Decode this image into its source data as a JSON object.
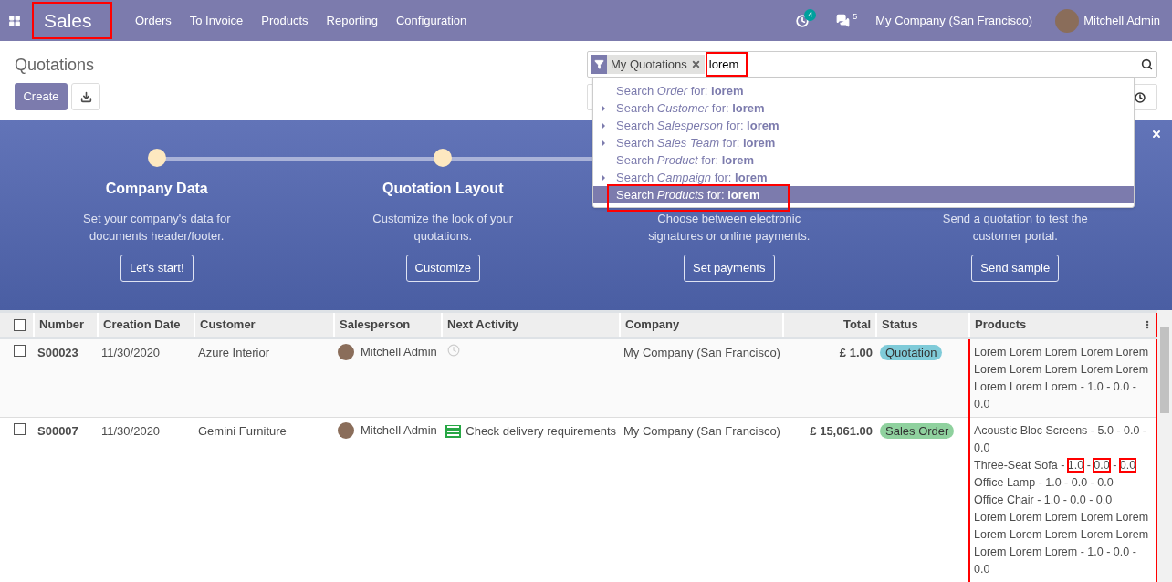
{
  "navbar": {
    "app_title": "Sales",
    "app_title_annotated": true,
    "menu": [
      "Orders",
      "To Invoice",
      "Products",
      "Reporting",
      "Configuration"
    ],
    "activity_count": "4",
    "message_count": "5",
    "company": "My Company (San Francisco)",
    "user": "Mitchell Admin"
  },
  "control_panel": {
    "title": "Quotations",
    "create_button": "Create",
    "search": {
      "facet": "My Quotations",
      "value": "lorem",
      "value_annotated": true
    },
    "suggestions": [
      {
        "text": "Search *Order* for: **lorem**",
        "expandable": false,
        "selected": false,
        "annotated": false
      },
      {
        "text": "Search *Customer* for: **lorem**",
        "expandable": true,
        "selected": false,
        "annotated": false
      },
      {
        "text": "Search *Salesperson* for: **lorem**",
        "expandable": true,
        "selected": false,
        "annotated": false
      },
      {
        "text": "Search *Sales Team* for: **lorem**",
        "expandable": true,
        "selected": false,
        "annotated": false
      },
      {
        "text": "Search *Product* for: **lorem**",
        "expandable": false,
        "selected": false,
        "annotated": false
      },
      {
        "text": "Search *Campaign* for: **lorem**",
        "expandable": true,
        "selected": false,
        "annotated": false
      },
      {
        "text": "Search *Products* for: **lorem**",
        "expandable": false,
        "selected": true,
        "annotated": true
      }
    ]
  },
  "onboarding": {
    "steps": [
      {
        "title": "Company Data",
        "description_lines": [
          "Set your company's data for",
          "documents header/footer."
        ],
        "button": "Let's start!"
      },
      {
        "title": "Quotation Layout",
        "description_lines": [
          "Customize the look of your",
          "quotations."
        ],
        "button": "Customize"
      },
      {
        "description_lines": [
          "Choose between electronic",
          "signatures or online payments."
        ],
        "button": "Set payments"
      },
      {
        "description_lines": [
          "Send a quotation to test the",
          "customer portal."
        ],
        "button": "Send sample"
      }
    ]
  },
  "table": {
    "all_selected": false,
    "columns": [
      "Number",
      "Creation Date",
      "Customer",
      "Salesperson",
      "Next Activity",
      "Company",
      "Total",
      "Status",
      "Products"
    ],
    "products_column_annotated": true,
    "rows": [
      {
        "selected": false,
        "number": "S00023",
        "date": "11/30/2020",
        "customer": "Azure Interior",
        "salesperson": "Mitchell Admin",
        "activity": {
          "kind": "none"
        },
        "company": "My Company (San Francisco)",
        "total": "£ 1.00",
        "status": "Quotation",
        "color": "#7fcbd9",
        "products": [
          {
            "segments": [
              {
                "text": "Lorem Lorem Lorem Lorem Lorem Lorem Lorem Lorem Lorem Lorem Lorem Lorem Lorem - 1.0 - 0.0 - 0.0",
                "marked": false
              }
            ]
          }
        ]
      },
      {
        "selected": false,
        "number": "S00007",
        "date": "11/30/2020",
        "customer": "Gemini Furniture",
        "salesperson": "Mitchell Admin",
        "activity": {
          "kind": "task",
          "text": "Check delivery requirements"
        },
        "company": "My Company (San Francisco)",
        "total": "£ 15,061.00",
        "status": "Sales Order",
        "color": "#8fd19e",
        "products": [
          {
            "segments": [
              {
                "text": "Acoustic Bloc Screens - 5.0 - 0.0 - 0.0",
                "marked": false
              }
            ]
          },
          {
            "segments": [
              {
                "text": "Three-Seat Sofa - ",
                "marked": false
              },
              {
                "text": "1.0",
                "marked": true
              },
              {
                "text": " - ",
                "marked": false
              },
              {
                "text": "0.0",
                "marked": true
              },
              {
                "text": " - ",
                "marked": false
              },
              {
                "text": "0.0",
                "marked": true
              }
            ]
          },
          {
            "segments": [
              {
                "text": "Office Lamp - 1.0 - 0.0 - 0.0",
                "marked": false
              }
            ]
          },
          {
            "segments": [
              {
                "text": "Office Chair - 1.0 - 0.0 - 0.0",
                "marked": false
              }
            ]
          },
          {
            "segments": [
              {
                "text": "Lorem Lorem Lorem Lorem Lorem Lorem Lorem Lorem Lorem Lorem Lorem Lorem Lorem - 1.0 - 0.0 - 0.0",
                "marked": false
              }
            ]
          }
        ]
      }
    ]
  }
}
